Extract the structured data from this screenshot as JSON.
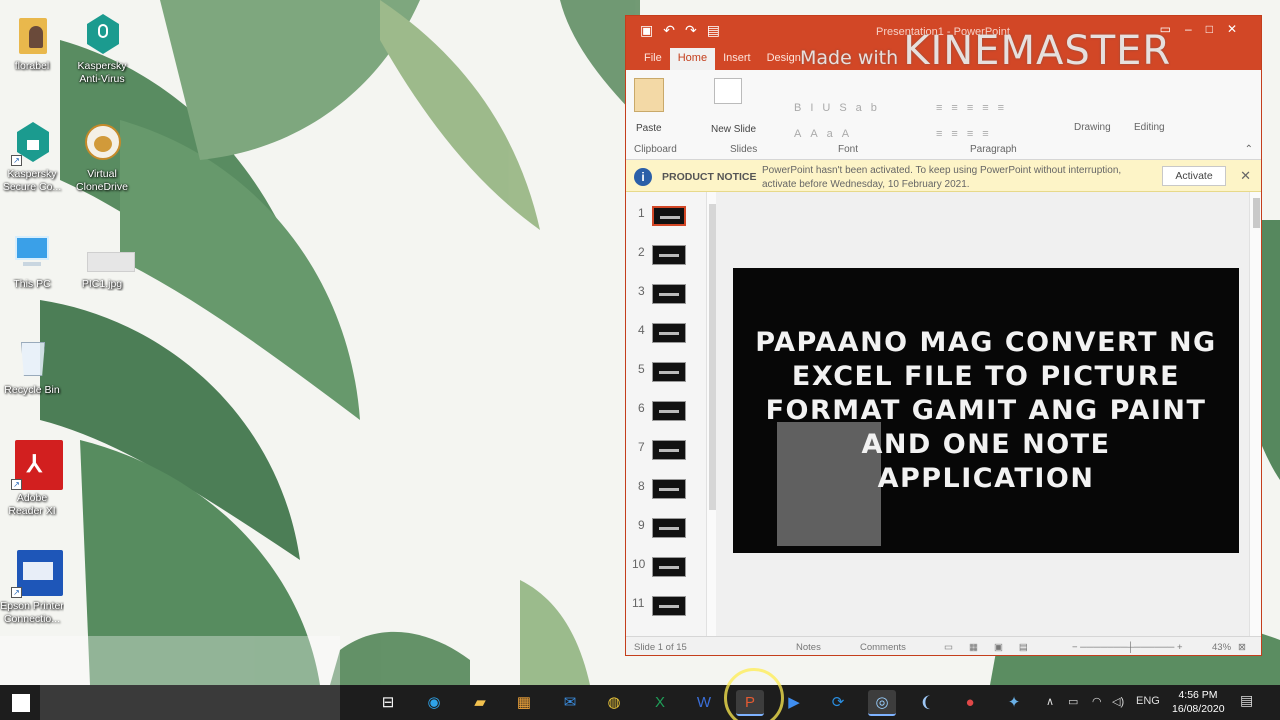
{
  "desktop": {
    "icons": [
      {
        "label": "florabel"
      },
      {
        "label": "Kaspersky Anti-Virus"
      },
      {
        "label": "Kaspersky Secure Co..."
      },
      {
        "label": "Virtual CloneDrive"
      },
      {
        "label": "This PC"
      },
      {
        "label": "PIC1.jpg"
      },
      {
        "label": "Recycle Bin"
      },
      {
        "label": "Adobe Reader XI"
      },
      {
        "label": "Epson Printer Connectio..."
      }
    ]
  },
  "watermark": {
    "small": "Made with",
    "big": "KINEMASTER"
  },
  "powerpoint": {
    "window_title": "Presentation1 - PowerPoint",
    "tabs": [
      "File",
      "Home",
      "Insert",
      "Design"
    ],
    "ribbon": {
      "paste": "Paste",
      "new_slide": "New Slide",
      "drawing": "Drawing",
      "editing": "Editing",
      "groups": [
        "Clipboard",
        "Slides",
        "Font",
        "Paragraph"
      ]
    },
    "notice": {
      "title": "PRODUCT NOTICE",
      "message": "PowerPoint hasn't been activated. To keep using PowerPoint without interruption, activate before Wednesday, 10 February 2021.",
      "button": "Activate"
    },
    "thumbnails": [
      "1",
      "2",
      "3",
      "4",
      "5",
      "6",
      "7",
      "8",
      "9",
      "10",
      "11"
    ],
    "selected_slide": 1,
    "slide_title": "PAPAANO MAG CONVERT NG EXCEL FILE TO PICTURE FORMAT GAMIT ANG PAINT AND ONE NOTE APPLICATION",
    "status": {
      "slide_of": "Slide 1 of 15",
      "notes": "Notes",
      "comments": "Comments",
      "zoom": "43%"
    }
  },
  "taskbar": {
    "time": "4:56 PM",
    "date": "16/08/2020",
    "language": "ENG",
    "active_app": "PowerPoint"
  },
  "colors": {
    "ppt_accent": "#d24726",
    "taskbar": "#1d1d1d",
    "notice_bg": "#fdf4c7"
  }
}
